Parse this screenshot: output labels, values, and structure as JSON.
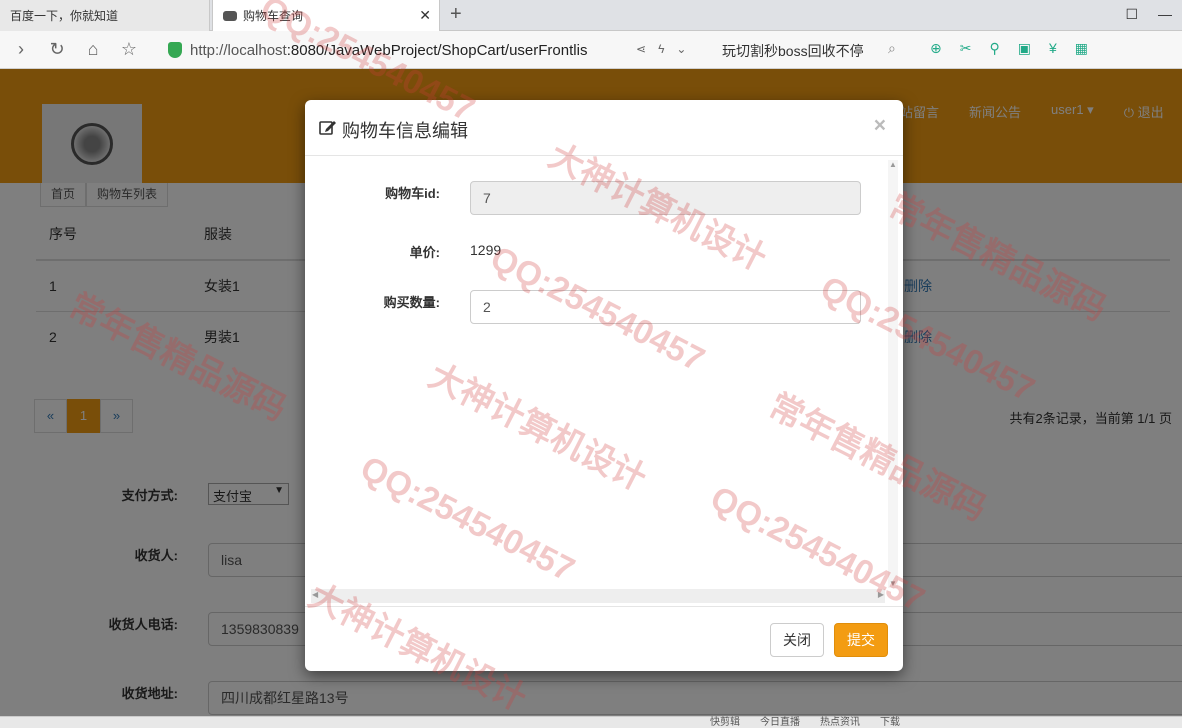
{
  "browser": {
    "tabs": [
      {
        "title": "百度一下，你就知道",
        "active": false
      },
      {
        "title": "购物车查询",
        "active": true
      }
    ],
    "new_tab": "+",
    "url_host": "http://localhost",
    "url_rest": ":8080/JavaWebProject/ShopCart/userFrontlis",
    "search_hint": "玩切割秒boss回收不停",
    "window_icons": [
      "☐",
      "—"
    ]
  },
  "site": {
    "nav": [
      "站留言",
      "新闻公告",
      "user1 ▾",
      "⏻  退出"
    ],
    "subtabs": [
      "首页",
      "购物车列表"
    ]
  },
  "cart_table": {
    "headers": [
      "序号",
      "服装"
    ],
    "rows": [
      {
        "index": "1",
        "name": "女装1",
        "action": "删除"
      },
      {
        "index": "2",
        "name": "男装1",
        "action": "删除"
      }
    ]
  },
  "pager": {
    "prev": "«",
    "current": "1",
    "next": "»"
  },
  "record_info": "共有2条记录，当前第 1/1 页",
  "order_form": {
    "pay_label": "支付方式:",
    "pay_value": "支付宝",
    "receiver_label": "收货人:",
    "receiver_value": "lisa",
    "phone_label": "收货人电话:",
    "phone_value": "1359830839",
    "address_label": "收货地址:",
    "address_value": "四川成都红星路13号"
  },
  "modal": {
    "title": "购物车信息编辑",
    "close_symbol": "×",
    "fields": {
      "cart_id_label": "购物车id:",
      "cart_id_value": "7",
      "price_label": "单价:",
      "price_value": "1299",
      "qty_label": "购买数量:",
      "qty_value": "2"
    },
    "close_button": "关闭",
    "submit_button": "提交"
  },
  "statusbar": [
    "快剪辑",
    "今日直播",
    "热点资讯",
    "下载"
  ],
  "watermarks": [
    "QQ:254540457",
    "大神计算机设计",
    "常年售精品源码"
  ],
  "colors": {
    "accent": "#f39c12",
    "link": "#337ab7",
    "watermark": "#d23c3c"
  }
}
